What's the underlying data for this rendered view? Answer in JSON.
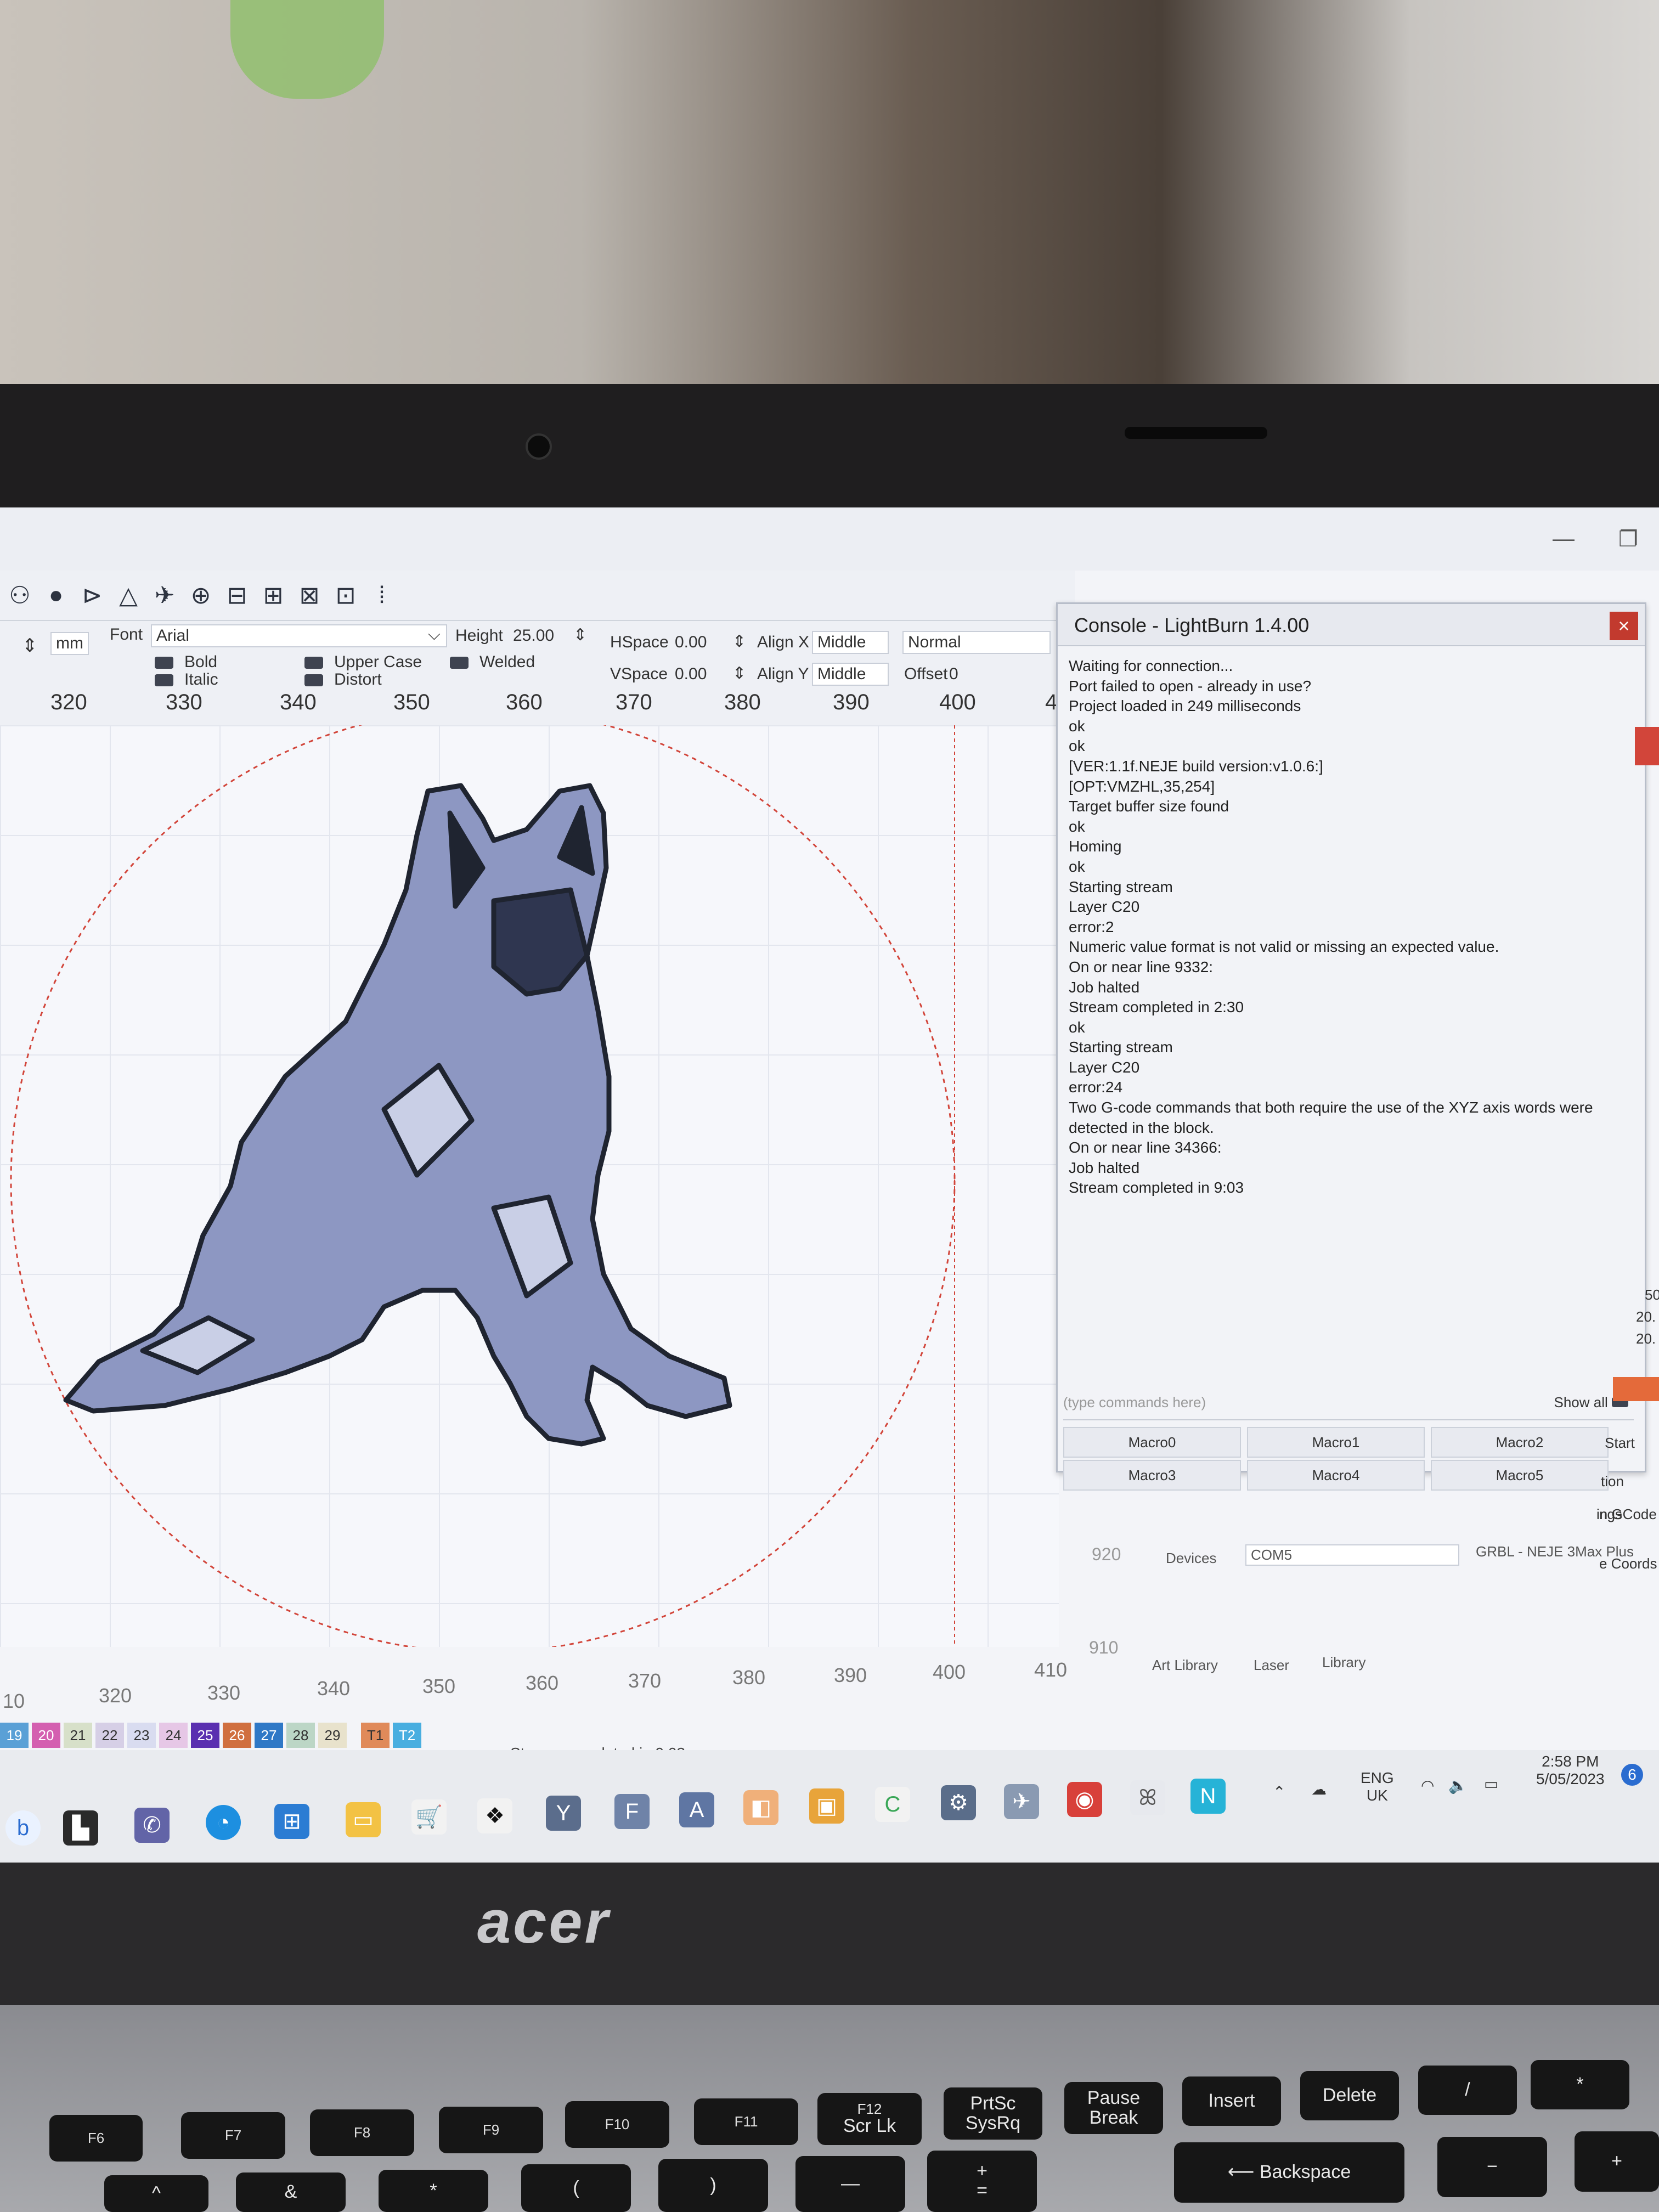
{
  "window": {
    "minimize": "—",
    "restore": "❐"
  },
  "toolbar_icons": [
    "group-icon",
    "user-icon",
    "flip-icon",
    "mirror-icon",
    "send-icon",
    "target-icon",
    "align-icon",
    "distribute-icon",
    "spacing-icon",
    "resize-icon",
    "dots-icon"
  ],
  "textbar": {
    "units": "mm",
    "font_label": "Font",
    "font_value": "Arial",
    "height_label": "Height",
    "height_value": "25.00",
    "hspace_label": "HSpace",
    "hspace_value": "0.00",
    "vspace_label": "VSpace",
    "vspace_value": "0.00",
    "alignx_label": "Align X",
    "alignx_value": "Middle",
    "aligny_label": "Align Y",
    "aligny_value": "Middle",
    "mode_value": "Normal",
    "offset_label": "Offset",
    "offset_value": "0",
    "bold": "Bold",
    "italic": "Italic",
    "upper_case": "Upper Case",
    "distort": "Distort",
    "welded": "Welded"
  },
  "ruler_top": [
    "320",
    "330",
    "340",
    "350",
    "360",
    "370",
    "380",
    "390",
    "400",
    "4"
  ],
  "console": {
    "title": "Console - LightBurn 1.4.00",
    "close": "×",
    "lines": [
      "Waiting for connection...",
      "Port failed to open - already in use?",
      "Project loaded in 249 milliseconds",
      "ok",
      "ok",
      "[VER:1.1f.NEJE build version:v1.0.6:]",
      "[OPT:VMZHL,35,254]",
      "Target buffer size found",
      "ok",
      "Homing",
      "ok",
      "Starting stream",
      "Layer C20",
      "error:2",
      "Numeric value format is not valid or missing an expected value.",
      "On or near line 9332:",
      "Job halted",
      "Stream completed in 2:30",
      "ok",
      "Starting stream",
      "Layer C20",
      "error:24",
      "Two G-code commands that both require the use of the XYZ axis words were detected in the block.",
      "On or near line 34366:",
      "Job halted",
      "Stream completed in 9:03"
    ],
    "command_placeholder": "(type commands here)",
    "show_all": "Show all",
    "macros": [
      "Macro0",
      "Macro1",
      "Macro2",
      "Macro3",
      "Macro4",
      "Macro5"
    ]
  },
  "right_panel": {
    "values": [
      "50",
      "20.",
      "20."
    ],
    "start": "Start",
    "gcode": "in GCode",
    "coords": "e Coords",
    "tion": "tion",
    "ngs": "ngs"
  },
  "devices_row": {
    "ruler_left": "920",
    "devices": "Devices",
    "port": "COM5",
    "device": "GRBL - NEJE 3Max Plus"
  },
  "bottom_tabs": {
    "ruler_left": "910",
    "art_library": "Art Library",
    "laser": "Laser",
    "library": "Library"
  },
  "ruler_bottom": [
    "10",
    "320",
    "330",
    "340",
    "350",
    "360",
    "370",
    "380",
    "390",
    "400",
    "410"
  ],
  "palette": [
    {
      "label": "19",
      "color": "#5aa0d6"
    },
    {
      "label": "20",
      "color": "#d45fb0"
    },
    {
      "label": "21",
      "color": "#d7e0c9"
    },
    {
      "label": "22",
      "color": "#d6cfe6"
    },
    {
      "label": "23",
      "color": "#d9dcf0"
    },
    {
      "label": "24",
      "color": "#e6c7e6"
    },
    {
      "label": "25",
      "color": "#5a2fb0"
    },
    {
      "label": "26",
      "color": "#d06f3f"
    },
    {
      "label": "27",
      "color": "#2f78c6"
    },
    {
      "label": "28",
      "color": "#bcd6c6"
    },
    {
      "label": "29",
      "color": "#e8e2cc"
    },
    {
      "label": "T1",
      "color": "#e08a5a"
    },
    {
      "label": "T2",
      "color": "#48aee0"
    }
  ],
  "status": "Stream completed in 9:03",
  "tray": {
    "lang": "ENG",
    "region": "UK",
    "time": "2:58 PM",
    "date": "5/05/2023",
    "notif": "6"
  },
  "taskbar_labels": {
    "y": "Y",
    "f": "F",
    "a": "A",
    "n": "N",
    "b": "b",
    "c": "C"
  },
  "laptop_brand": "acer",
  "keys": {
    "f6": "F6",
    "f7": "F7",
    "f8": "F8",
    "f9": "F9",
    "f10": "F10",
    "f11": "F11",
    "f12": "F12",
    "scrlk": "Scr Lk",
    "prtsc": "PrtSc",
    "sysrq": "SysRq",
    "pause": "Pause",
    "break": "Break",
    "insert": "Insert",
    "delete": "Delete",
    "slash": "/",
    "star": "*",
    "backspace": "Backspace",
    "minus": "−",
    "plus": "+",
    "caret": "^",
    "amp": "&",
    "asterisk": "*",
    "lparen": "(",
    "rparen": ")",
    "eq_plus": "+",
    "eq": "="
  }
}
